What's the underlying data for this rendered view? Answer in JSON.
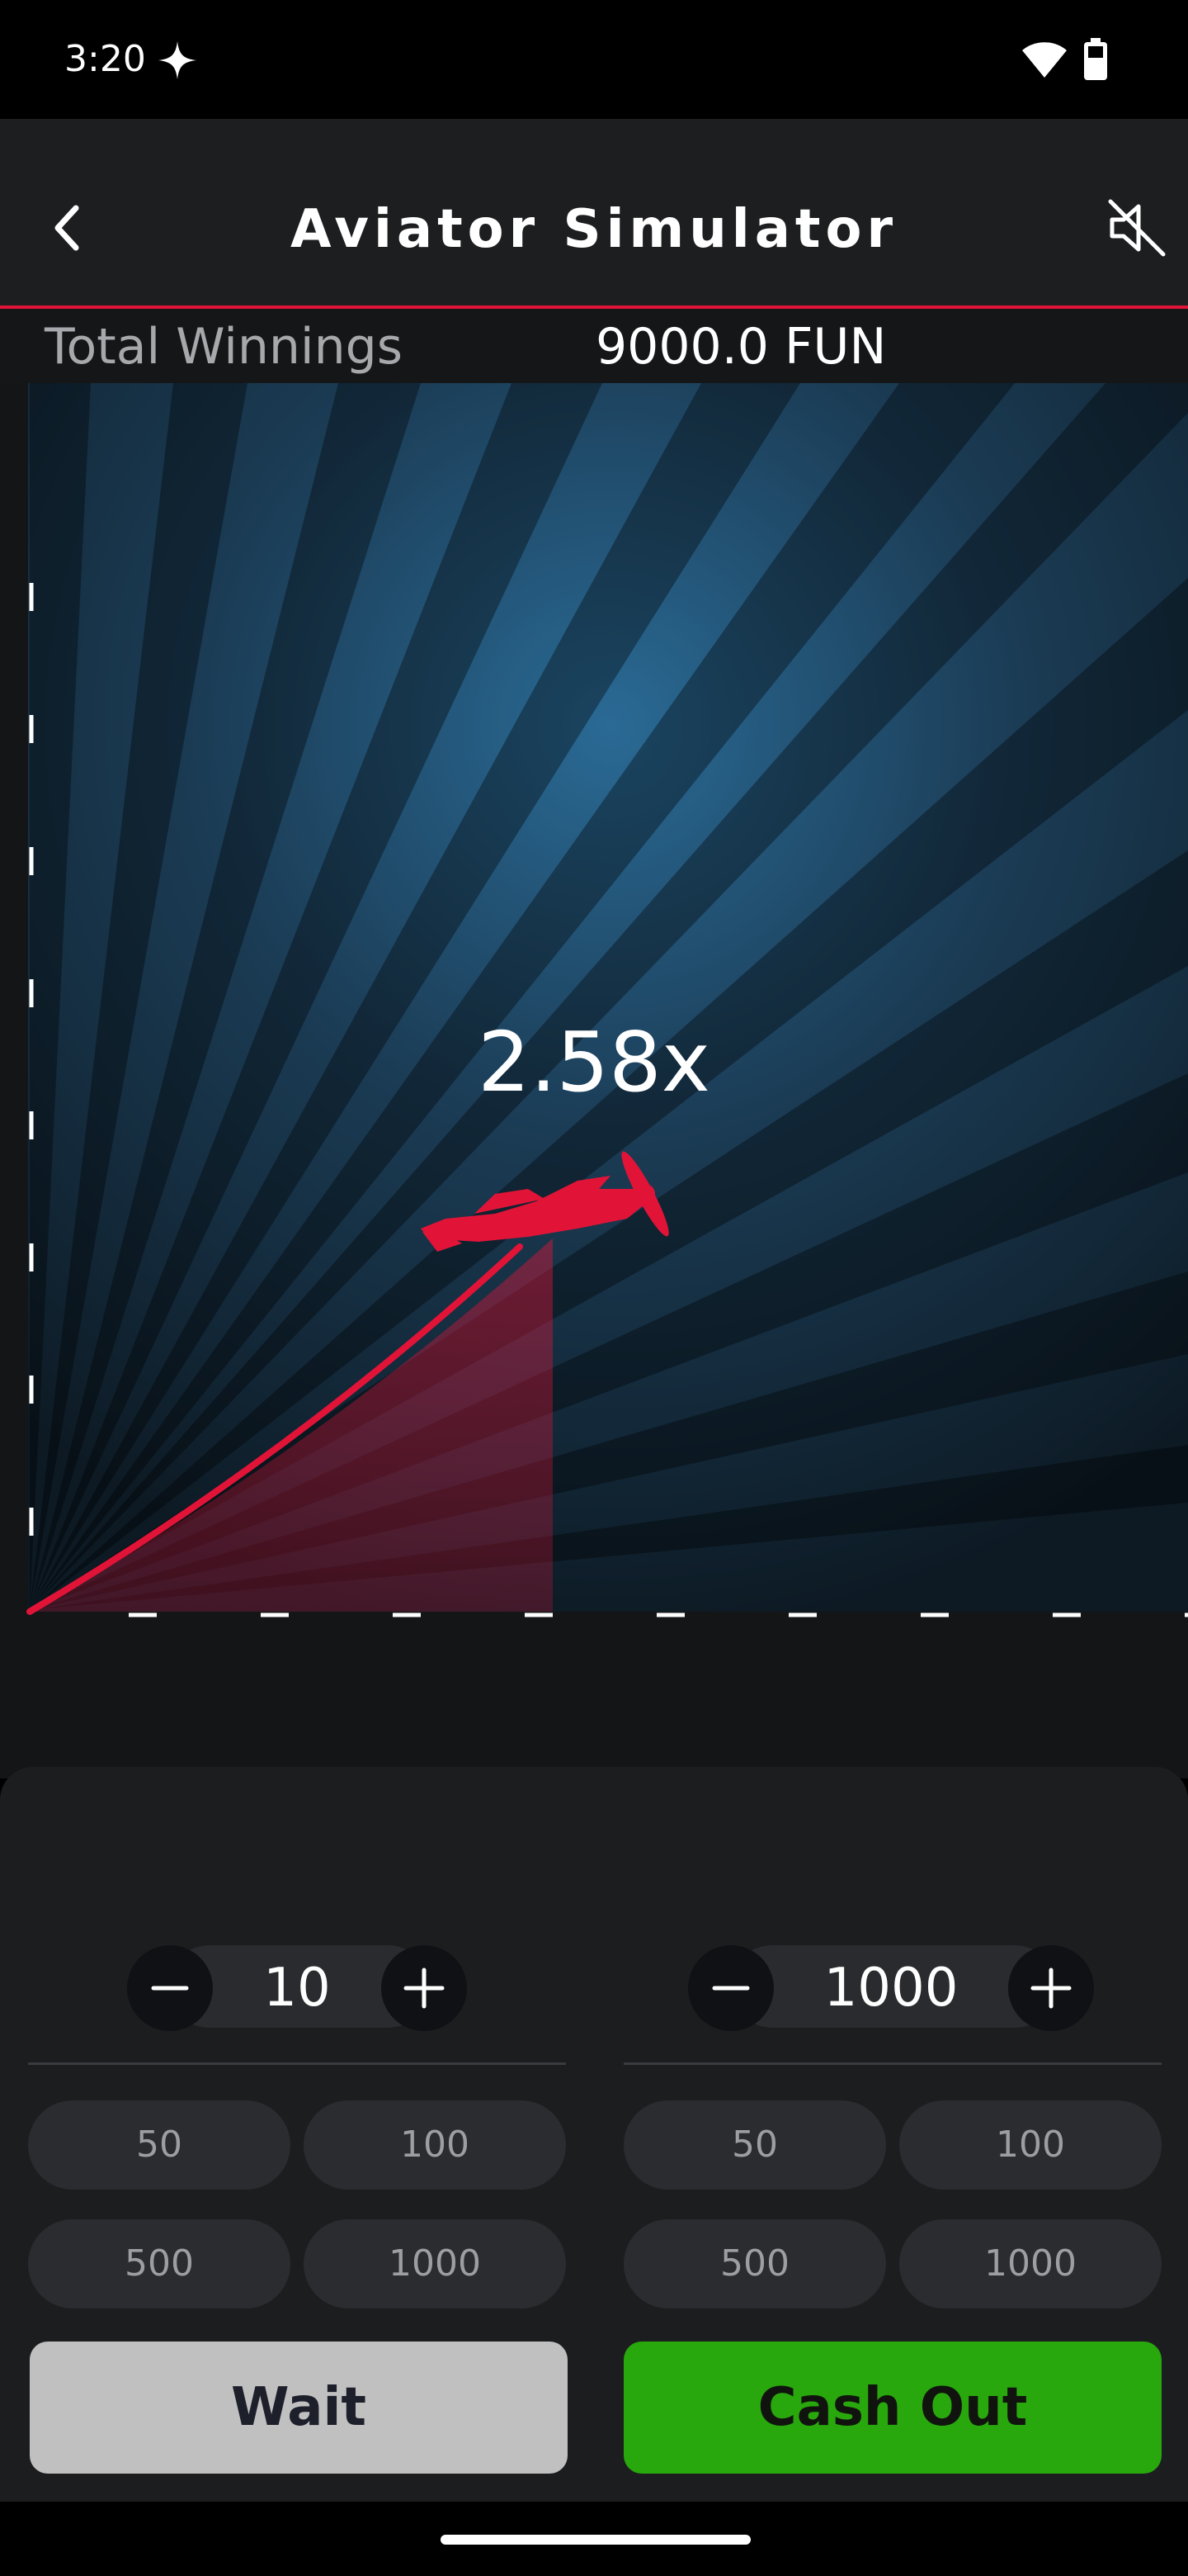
{
  "status_bar": {
    "time": "3:20",
    "icons": [
      "sparkle-icon",
      "wifi-icon",
      "battery-icon"
    ]
  },
  "header": {
    "title": "Aviator Simulator",
    "back_icon": "chevron-left-icon",
    "mute_icon": "speaker-muted-icon"
  },
  "winnings": {
    "label": "Total Winnings",
    "value": "9000.0 FUN"
  },
  "game": {
    "multiplier": "2.58x",
    "plane_icon": "plane-icon",
    "colors": {
      "curve": "#e11438",
      "sky_glow": "#2a6a95",
      "background": "#141517"
    }
  },
  "bets": [
    {
      "amount": "10",
      "decrease_icon": "minus-icon",
      "increase_icon": "plus-icon",
      "quick_amounts": [
        "50",
        "100",
        "500",
        "1000"
      ],
      "action_label": "Wait",
      "action_color": "#c0c0c0"
    },
    {
      "amount": "1000",
      "decrease_icon": "minus-icon",
      "increase_icon": "plus-icon",
      "quick_amounts": [
        "50",
        "100",
        "500",
        "1000"
      ],
      "action_label": "Cash Out",
      "action_color": "#28a80d"
    }
  ]
}
